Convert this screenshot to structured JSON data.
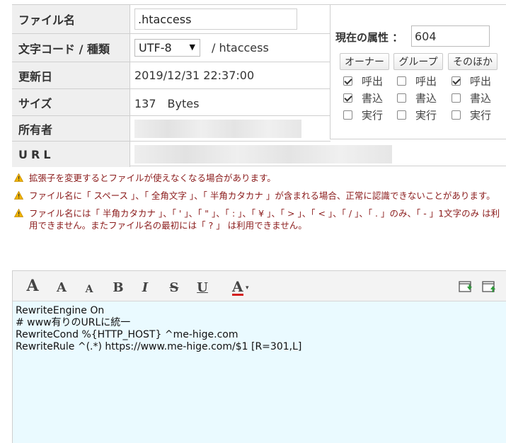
{
  "file_info": {
    "filename_label": "ファイル名",
    "filename_value": ".htaccess",
    "encoding_label": "文字コード / 種類",
    "encoding_value": "UTF-8",
    "type_value": "/ htaccess",
    "updated_label": "更新日",
    "updated_value": "2019/12/31 22:37:00",
    "size_label": "サイズ",
    "size_value": "137　Bytes",
    "owner_label": "所有者",
    "url_label": "URL"
  },
  "permissions": {
    "title": "現在の属性 ：",
    "value": "604",
    "columns": [
      {
        "label": "オーナー",
        "read": {
          "label": "呼出",
          "checked": true
        },
        "write": {
          "label": "書込",
          "checked": true
        },
        "exec": {
          "label": "実行",
          "checked": false
        }
      },
      {
        "label": "グループ",
        "read": {
          "label": "呼出",
          "checked": false
        },
        "write": {
          "label": "書込",
          "checked": false
        },
        "exec": {
          "label": "実行",
          "checked": false
        }
      },
      {
        "label": "そのほか",
        "read": {
          "label": "呼出",
          "checked": true
        },
        "write": {
          "label": "書込",
          "checked": false
        },
        "exec": {
          "label": "実行",
          "checked": false
        }
      }
    ]
  },
  "warnings": [
    "拡張子を変更するとファイルが使えなくなる場合があります。",
    "ファイル名に「 スペース 」、「 全角文字 」、「 半角カタカナ 」が含まれる場合、正常に認識できないことがあります。",
    "ファイル名には「 半角カタカナ 」、「 ' 」、「 \" 」、「 : 」、「 ¥ 」、「 > 」、「 < 」、「 / 」、「 . 」のみ、「 - 」1文字のみ は利用できません。またファイル名の最初には「 ? 」 は利用できません。"
  ],
  "toolbar": {
    "font_large": "A",
    "font_medium": "A",
    "font_small": "A",
    "bold": "B",
    "italic": "I",
    "strike": "S",
    "underline": "U",
    "color": "A",
    "color_caret": "▾",
    "color_bar": "#d42020"
  },
  "code_lines": [
    "RewriteEngine On",
    "# www有りのURLに統一",
    "RewriteCond %{HTTP_HOST} ^me-hige.com",
    "RewriteRule ^(.*) https://www.me-hige.com/$1 [R=301,L]"
  ]
}
